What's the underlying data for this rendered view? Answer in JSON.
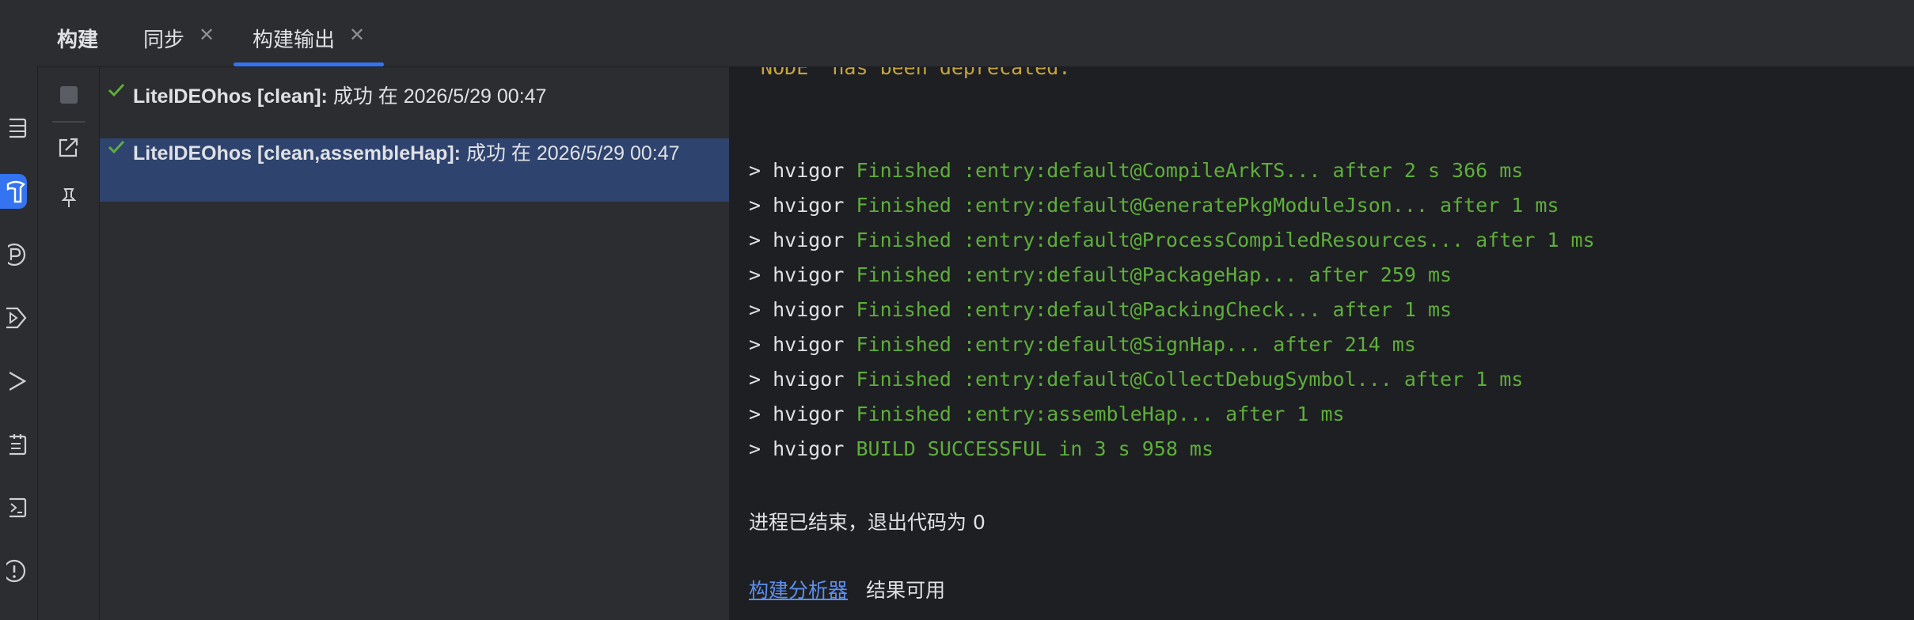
{
  "tabs": {
    "title": "构建",
    "items": [
      {
        "label": "同步"
      },
      {
        "label": "构建输出"
      }
    ]
  },
  "activity_icons": [
    "table-icon",
    "build-icon",
    "profiler-icon",
    "run-tag-icon",
    "play-icon",
    "task-icon",
    "terminal-icon",
    "problems-icon"
  ],
  "build_tree": [
    {
      "project": "LiteIDEOhos [clean]:",
      "status": "成功 在 2026/5/29 00:47"
    },
    {
      "project": "LiteIDEOhos [clean,assembleHap]:",
      "status": "成功 在 2026/5/29 00:47"
    }
  ],
  "console": {
    "warning_line": "`NODE` has been deprecated.",
    "lines": [
      {
        "prompt": "> hvigor",
        "text": "Finished :entry:default@CompileArkTS... after 2 s 366 ms"
      },
      {
        "prompt": "> hvigor",
        "text": "Finished :entry:default@GeneratePkgModuleJson... after 1 ms"
      },
      {
        "prompt": "> hvigor",
        "text": "Finished :entry:default@ProcessCompiledResources... after 1 ms"
      },
      {
        "prompt": "> hvigor",
        "text": "Finished :entry:default@PackageHap... after 259 ms"
      },
      {
        "prompt": "> hvigor",
        "text": "Finished :entry:default@PackingCheck... after 1 ms"
      },
      {
        "prompt": "> hvigor",
        "text": "Finished :entry:default@SignHap... after 214 ms"
      },
      {
        "prompt": "> hvigor",
        "text": "Finished :entry:default@CollectDebugSymbol... after 1 ms"
      },
      {
        "prompt": "> hvigor",
        "text": "Finished :entry:assembleHap... after 1 ms"
      },
      {
        "prompt": "> hvigor",
        "text": "BUILD SUCCESSFUL in 3 s 958 ms"
      }
    ],
    "exit_message": "进程已结束，退出代码为 0",
    "analyzer_link": "构建分析器",
    "analyzer_suffix": "结果可用"
  },
  "colors": {
    "accent": "#3574f0",
    "success": "#5fae3c",
    "warning": "#c6a43b",
    "link": "#5c8fef",
    "selection": "#2e436e"
  }
}
